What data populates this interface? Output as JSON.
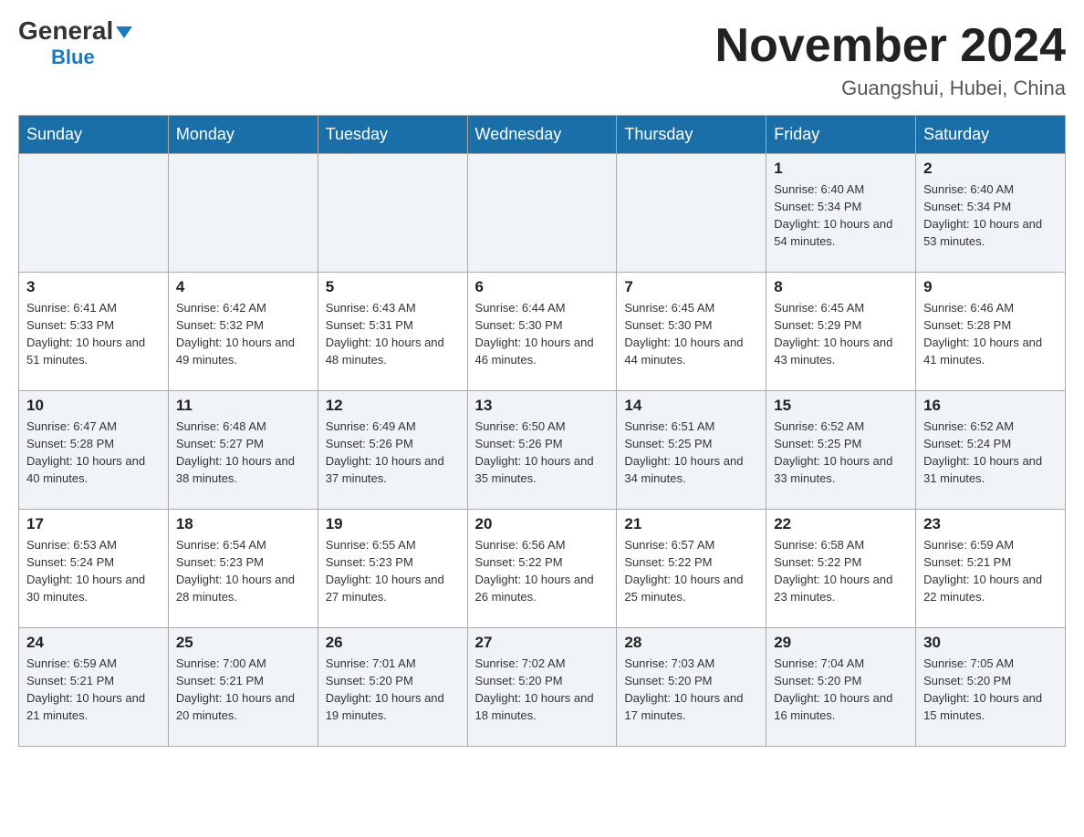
{
  "header": {
    "logo_general": "General",
    "logo_blue": "Blue",
    "month_title": "November 2024",
    "location": "Guangshui, Hubei, China"
  },
  "weekdays": [
    "Sunday",
    "Monday",
    "Tuesday",
    "Wednesday",
    "Thursday",
    "Friday",
    "Saturday"
  ],
  "weeks": [
    [
      {
        "day": "",
        "info": ""
      },
      {
        "day": "",
        "info": ""
      },
      {
        "day": "",
        "info": ""
      },
      {
        "day": "",
        "info": ""
      },
      {
        "day": "",
        "info": ""
      },
      {
        "day": "1",
        "info": "Sunrise: 6:40 AM\nSunset: 5:34 PM\nDaylight: 10 hours and 54 minutes."
      },
      {
        "day": "2",
        "info": "Sunrise: 6:40 AM\nSunset: 5:34 PM\nDaylight: 10 hours and 53 minutes."
      }
    ],
    [
      {
        "day": "3",
        "info": "Sunrise: 6:41 AM\nSunset: 5:33 PM\nDaylight: 10 hours and 51 minutes."
      },
      {
        "day": "4",
        "info": "Sunrise: 6:42 AM\nSunset: 5:32 PM\nDaylight: 10 hours and 49 minutes."
      },
      {
        "day": "5",
        "info": "Sunrise: 6:43 AM\nSunset: 5:31 PM\nDaylight: 10 hours and 48 minutes."
      },
      {
        "day": "6",
        "info": "Sunrise: 6:44 AM\nSunset: 5:30 PM\nDaylight: 10 hours and 46 minutes."
      },
      {
        "day": "7",
        "info": "Sunrise: 6:45 AM\nSunset: 5:30 PM\nDaylight: 10 hours and 44 minutes."
      },
      {
        "day": "8",
        "info": "Sunrise: 6:45 AM\nSunset: 5:29 PM\nDaylight: 10 hours and 43 minutes."
      },
      {
        "day": "9",
        "info": "Sunrise: 6:46 AM\nSunset: 5:28 PM\nDaylight: 10 hours and 41 minutes."
      }
    ],
    [
      {
        "day": "10",
        "info": "Sunrise: 6:47 AM\nSunset: 5:28 PM\nDaylight: 10 hours and 40 minutes."
      },
      {
        "day": "11",
        "info": "Sunrise: 6:48 AM\nSunset: 5:27 PM\nDaylight: 10 hours and 38 minutes."
      },
      {
        "day": "12",
        "info": "Sunrise: 6:49 AM\nSunset: 5:26 PM\nDaylight: 10 hours and 37 minutes."
      },
      {
        "day": "13",
        "info": "Sunrise: 6:50 AM\nSunset: 5:26 PM\nDaylight: 10 hours and 35 minutes."
      },
      {
        "day": "14",
        "info": "Sunrise: 6:51 AM\nSunset: 5:25 PM\nDaylight: 10 hours and 34 minutes."
      },
      {
        "day": "15",
        "info": "Sunrise: 6:52 AM\nSunset: 5:25 PM\nDaylight: 10 hours and 33 minutes."
      },
      {
        "day": "16",
        "info": "Sunrise: 6:52 AM\nSunset: 5:24 PM\nDaylight: 10 hours and 31 minutes."
      }
    ],
    [
      {
        "day": "17",
        "info": "Sunrise: 6:53 AM\nSunset: 5:24 PM\nDaylight: 10 hours and 30 minutes."
      },
      {
        "day": "18",
        "info": "Sunrise: 6:54 AM\nSunset: 5:23 PM\nDaylight: 10 hours and 28 minutes."
      },
      {
        "day": "19",
        "info": "Sunrise: 6:55 AM\nSunset: 5:23 PM\nDaylight: 10 hours and 27 minutes."
      },
      {
        "day": "20",
        "info": "Sunrise: 6:56 AM\nSunset: 5:22 PM\nDaylight: 10 hours and 26 minutes."
      },
      {
        "day": "21",
        "info": "Sunrise: 6:57 AM\nSunset: 5:22 PM\nDaylight: 10 hours and 25 minutes."
      },
      {
        "day": "22",
        "info": "Sunrise: 6:58 AM\nSunset: 5:22 PM\nDaylight: 10 hours and 23 minutes."
      },
      {
        "day": "23",
        "info": "Sunrise: 6:59 AM\nSunset: 5:21 PM\nDaylight: 10 hours and 22 minutes."
      }
    ],
    [
      {
        "day": "24",
        "info": "Sunrise: 6:59 AM\nSunset: 5:21 PM\nDaylight: 10 hours and 21 minutes."
      },
      {
        "day": "25",
        "info": "Sunrise: 7:00 AM\nSunset: 5:21 PM\nDaylight: 10 hours and 20 minutes."
      },
      {
        "day": "26",
        "info": "Sunrise: 7:01 AM\nSunset: 5:20 PM\nDaylight: 10 hours and 19 minutes."
      },
      {
        "day": "27",
        "info": "Sunrise: 7:02 AM\nSunset: 5:20 PM\nDaylight: 10 hours and 18 minutes."
      },
      {
        "day": "28",
        "info": "Sunrise: 7:03 AM\nSunset: 5:20 PM\nDaylight: 10 hours and 17 minutes."
      },
      {
        "day": "29",
        "info": "Sunrise: 7:04 AM\nSunset: 5:20 PM\nDaylight: 10 hours and 16 minutes."
      },
      {
        "day": "30",
        "info": "Sunrise: 7:05 AM\nSunset: 5:20 PM\nDaylight: 10 hours and 15 minutes."
      }
    ]
  ]
}
